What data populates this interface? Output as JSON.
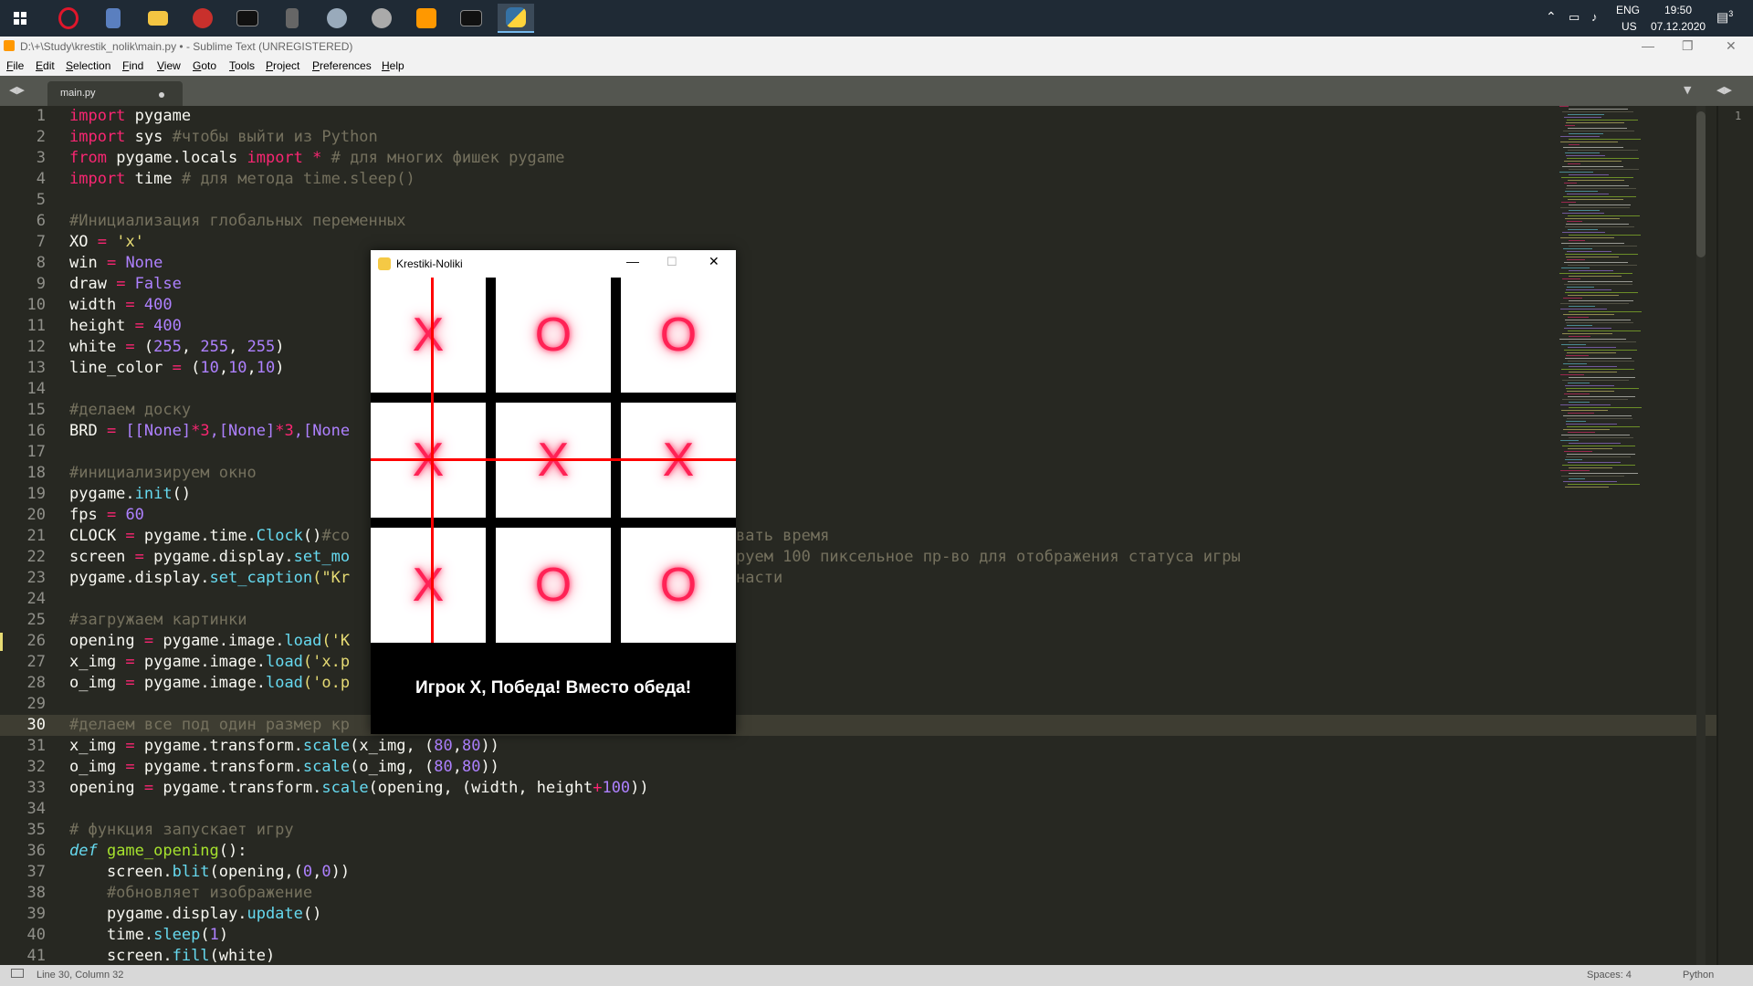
{
  "taskbar": {
    "tray_lang": "ENG",
    "tray_region": "US",
    "time": "19:50",
    "date": "07.12.2020",
    "notifications": "3",
    "icons": [
      "windows-start-icon",
      "opera-icon",
      "calculator-icon",
      "file-explorer-icon",
      "filezilla-icon",
      "terminal-icon",
      "storage-icon",
      "network-icon",
      "settings-icon",
      "sublime-text-icon",
      "cmd-icon",
      "python-icon"
    ]
  },
  "window": {
    "title": "D:\\+\\Study\\krestik_nolik\\main.py • - Sublime Text (UNREGISTERED)"
  },
  "menu": [
    "File",
    "Edit",
    "Selection",
    "Find",
    "View",
    "Goto",
    "Tools",
    "Project",
    "Preferences",
    "Help"
  ],
  "tab": {
    "label": "main.py"
  },
  "status": {
    "position": "Line 30, Column 32",
    "spaces": "Spaces: 4",
    "syntax": "Python"
  },
  "code_lines": [
    "1",
    "2",
    "3",
    "4",
    "5",
    "6",
    "7",
    "8",
    "9",
    "10",
    "11",
    "12",
    "13",
    "14",
    "15",
    "16",
    "17",
    "18",
    "19",
    "20",
    "21",
    "22",
    "23",
    "24",
    "25",
    "26",
    "27",
    "28",
    "29",
    "30",
    "31",
    "32",
    "33",
    "34",
    "35",
    "36",
    "37",
    "38",
    "39",
    "40",
    "41"
  ],
  "code": {
    "l1a": "import",
    "l1b": " pygame",
    "l2a": "import",
    "l2b": " sys ",
    "l2c": "#чтобы выйти из Python",
    "l3a": "from",
    "l3b": " pygame.locals ",
    "l3c": "import",
    "l3d": " * ",
    "l3e": "# для многих фишек pygame",
    "l4a": "import",
    "l4b": " time ",
    "l4c": "# для метода time.sleep()",
    "l6": "#Инициализация глобальных переменных",
    "l7a": "XO ",
    "l7b": "=",
    "l7c": " 'x'",
    "l8a": "win ",
    "l8b": "=",
    "l8c": " None",
    "l9a": "draw ",
    "l9b": "=",
    "l9c": " False",
    "l10a": "width ",
    "l10b": "=",
    "l10c": " 400",
    "l11a": "height ",
    "l11b": "=",
    "l11c": " 400",
    "l12a": "white ",
    "l12b": "=",
    "l12c": " (",
    "l12d": "255",
    ", ": ", ",
    "l12e": "255",
    "l12f": "255",
    "l12g": ")",
    "l13a": "line_color ",
    "l13b": "=",
    "l13c": " (",
    "l13d": "10",
    "l13e": "10",
    "l13f": "10",
    "l13g": ")",
    "l15": "#делаем доску",
    "l16a": "BRD ",
    "l16b": "=",
    "l16c": " [[None]",
    "l16d": "*3",
    "l16e": ",[None]",
    "l16f": "*3",
    "l16g": ",[None",
    "l18": "#инициализируем окно",
    "l19a": "pygame.",
    "l19b": "init",
    "l19c": "()",
    "l20a": "fps ",
    "l20b": "=",
    "l20c": " 60",
    "l21a": "CLOCK ",
    "l21b": "=",
    "l21c": " pygame.time.",
    "l21d": "Clock",
    "l21e": "()",
    "l21f": "#co",
    "l21g": "вать время",
    "l22a": "screen ",
    "l22b": "=",
    "l22c": " pygame.display.",
    "l22d": "set_mo",
    "l22e": "руем 100 пиксельное пр-во для отображения статуса игры",
    "l23a": "pygame.display.",
    "l23b": "set_caption",
    "l23c": "(\"Kr",
    "l23d": "насти",
    "l25": "#загружаем картинки",
    "l26a": "opening ",
    "l26b": "=",
    "l26c": " pygame.image.",
    "l26d": "load",
    "l26e": "('K",
    "l27a": "x_img ",
    "l27b": "=",
    "l27c": " pygame.image.",
    "l27d": "load",
    "l27e": "('x.p",
    "l28a": "o_img ",
    "l28b": "=",
    "l28c": " pygame.image.",
    "l28d": "load",
    "l28e": "('o.p",
    "l30": "#делаем все под один размер кр",
    "l31a": "x_img ",
    "l31b": "=",
    "l31c": " pygame.transform.",
    "l31d": "scale",
    "l31e": "(x_img, (",
    "l31f": "80",
    "l31g": ",",
    "l31h": "80",
    "l31i": "))",
    "l32a": "o_img ",
    "l32b": "=",
    "l32c": " pygame.transform.",
    "l32d": "scale",
    "l32e": "(o_img, (",
    "l32f": "80",
    "l32g": ",",
    "l32h": "80",
    "l32i": "))",
    "l33a": "opening ",
    "l33b": "=",
    "l33c": " pygame.transform.",
    "l33d": "scale",
    "l33e": "(opening, (width, height",
    "l33f": "+",
    "l33g": "100",
    "l33h": "))",
    "l35": "# функция запускает игру",
    "l36a": "def",
    "l36b": " game_opening",
    "l36c": "():",
    "l37a": "    screen.",
    "l37b": "blit",
    "l37c": "(opening,(",
    "l37d": "0",
    "l37e": ",",
    "l37f": "0",
    "l37g": "))",
    "l38": "    #обновляет изображение",
    "l39a": "    pygame.display.",
    "l39b": "update",
    "l39c": "()",
    "l40a": "    time.",
    "l40b": "sleep",
    "l40c": "(",
    "l40d": "1",
    "l40e": ")",
    "l41a": "    screen.",
    "l41b": "fill",
    "l41c": "(white)"
  },
  "game": {
    "title": "Krestiki-Noliki",
    "board": [
      [
        "X",
        "O",
        "O"
      ],
      [
        "X",
        "X",
        "X"
      ],
      [
        "X",
        "O",
        "O"
      ]
    ],
    "status": "Игрок X, Победа! Вместо обеда!"
  }
}
